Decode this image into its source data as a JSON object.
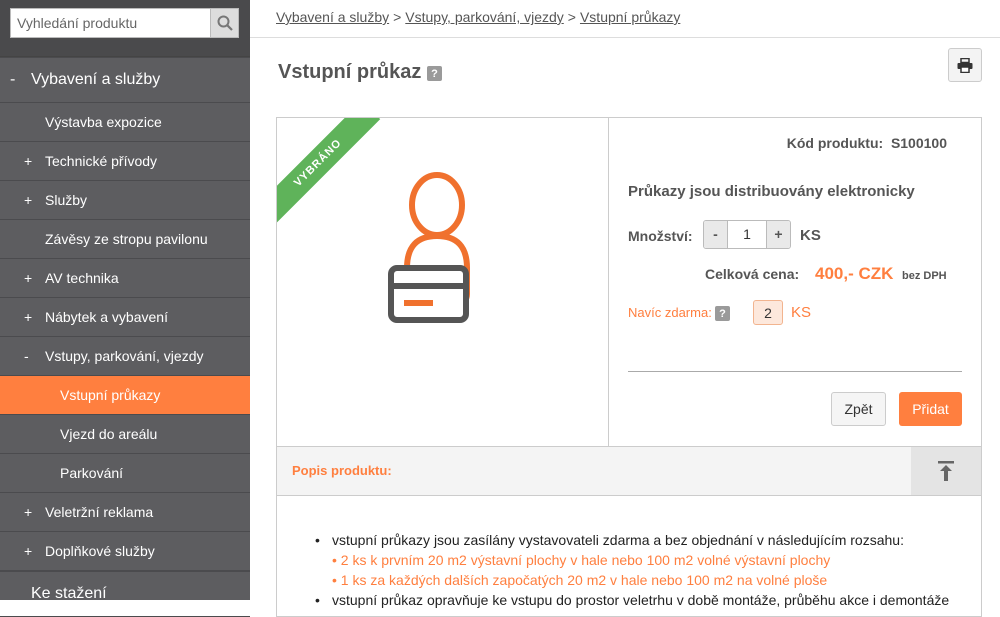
{
  "search": {
    "placeholder": "Vyhledání produktu"
  },
  "sidebar": {
    "items": [
      {
        "sign": "-",
        "label": "Vybavení a služby",
        "level": 0
      },
      {
        "sign": "",
        "label": "Výstavba expozice",
        "level": 1
      },
      {
        "sign": "+",
        "label": "Technické přívody",
        "level": 1
      },
      {
        "sign": "+",
        "label": "Služby",
        "level": 1
      },
      {
        "sign": "",
        "label": "Závěsy ze stropu pavilonu",
        "level": 1
      },
      {
        "sign": "+",
        "label": "AV technika",
        "level": 1
      },
      {
        "sign": "+",
        "label": "Nábytek a vybavení",
        "level": 1
      },
      {
        "sign": "-",
        "label": "Vstupy, parkování, vjezdy",
        "level": 1
      },
      {
        "sign": "",
        "label": "Vstupní průkazy",
        "level": 2,
        "active": true
      },
      {
        "sign": "",
        "label": "Vjezd do areálu",
        "level": 2
      },
      {
        "sign": "",
        "label": "Parkování",
        "level": 2
      },
      {
        "sign": "+",
        "label": "Veletržní reklama",
        "level": 1
      },
      {
        "sign": "+",
        "label": "Doplňkové služby",
        "level": 1
      },
      {
        "sign": "",
        "label": "Ke stažení",
        "level": 0
      }
    ]
  },
  "breadcrumb": {
    "items": [
      "Vybavení a služby",
      "Vstupy, parkování, vjezdy",
      "Vstupní průkazy"
    ],
    "separator": ">"
  },
  "page": {
    "title": "Vstupní průkaz",
    "help": "?"
  },
  "product": {
    "ribbon": "VYBRÁNO",
    "code_label": "Kód produktu:",
    "code": "S100100",
    "distribution": "Průkazy jsou distribuovány elektronicky",
    "qty_label": "Množství:",
    "qty_minus": "-",
    "qty_value": "1",
    "qty_plus": "+",
    "qty_unit": "KS",
    "total_label": "Celková cena:",
    "total_price": "400,- CZK",
    "vat_note": "bez DPH",
    "extra_label": "Navíc zdarma:",
    "extra_value": "2",
    "extra_unit": "KS",
    "back_button": "Zpět",
    "add_button": "Přidat"
  },
  "description": {
    "title": "Popis produktu:",
    "intro": "vstupní průkazy jsou zasílány vystavovateli zdarma a bez objednání v následujícím rozsahu:",
    "sub_items": [
      "• 2 ks k prvním 20 m2 výstavní plochy v hale nebo 100 m2 volné výstavní plochy",
      "• 1 ks za každých dalších započatých 20 m2 v hale nebo 100 m2 na volné ploše"
    ],
    "next": "vstupní průkaz opravňuje ke vstupu do prostor veletrhu v době montáže, průběhu akce i demontáže"
  },
  "colors": {
    "accent": "#ff7f3f",
    "sidebar": "#5d5d60",
    "ribbon": "#5fb35a"
  }
}
